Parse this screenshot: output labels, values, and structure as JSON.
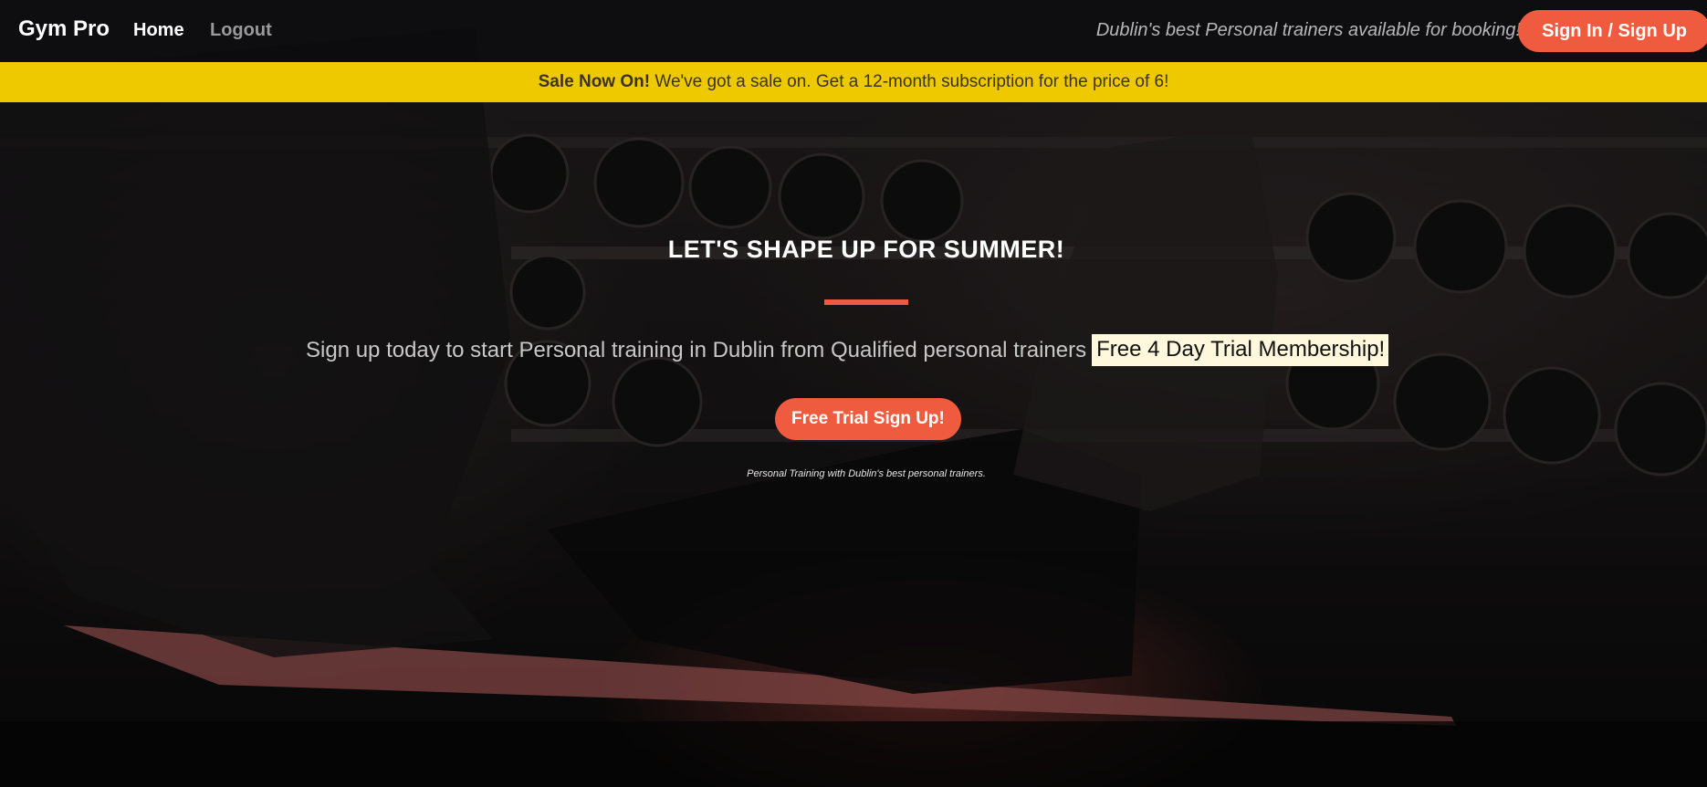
{
  "navbar": {
    "brand": "Gym Pro",
    "links": [
      {
        "label": "Home",
        "active": true
      },
      {
        "label": "Logout",
        "active": false
      }
    ],
    "tagline": "Dublin's best Personal trainers available for booking!",
    "signin_label": "Sign In / Sign Up"
  },
  "banner": {
    "bold": "Sale Now On!",
    "text": " We've got a sale on. Get a 12-month subscription for the price of 6!"
  },
  "hero": {
    "title": "LET'S SHAPE UP FOR SUMMER!",
    "subtitle": "Sign up today to start Personal training in Dublin from Qualified personal trainers",
    "highlight": "Free 4 Day Trial Membership!",
    "cta_label": "Free Trial Sign Up!",
    "caption": "Personal Training with Dublin's best personal trainers."
  },
  "colors": {
    "accent": "#ef5b3f",
    "banner": "#eec900",
    "highlight_bg": "#fff8dc",
    "navbar_bg": "#0a0a0c"
  }
}
